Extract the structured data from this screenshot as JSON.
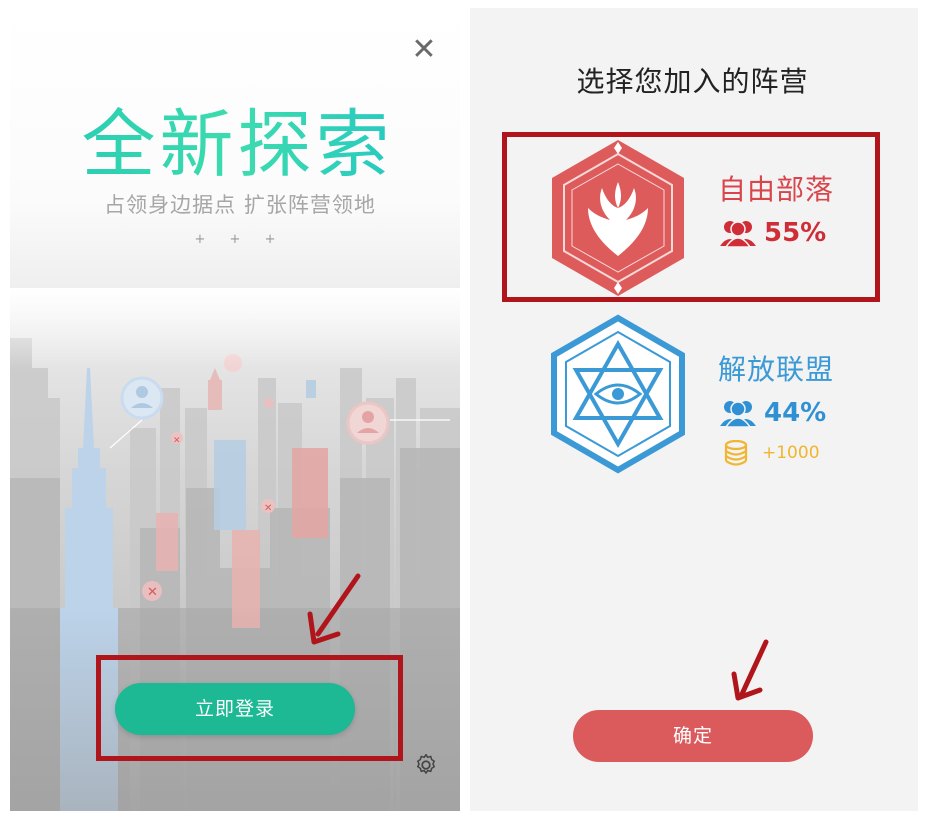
{
  "left": {
    "headline": "全新探索",
    "subline": "占领身边据点 扩张阵营领地",
    "decoration": "+ + +",
    "login_button": "立即登录",
    "close_icon": "close-icon",
    "settings_icon": "gear-icon"
  },
  "right": {
    "title": "选择您加入的阵营",
    "factions": [
      {
        "name": "自由部落",
        "percent": "55%",
        "color": "#d8464c",
        "emblem": "phoenix-icon"
      },
      {
        "name": "解放联盟",
        "percent": "44%",
        "color": "#3b9ad6",
        "emblem": "eye-star-icon",
        "bonus": "+1000"
      }
    ],
    "confirm_button": "确定"
  },
  "colors": {
    "login": "#1db894",
    "confirm": "#db5a5c",
    "highlight": "#b1151c",
    "coin": "#f1b52f"
  }
}
